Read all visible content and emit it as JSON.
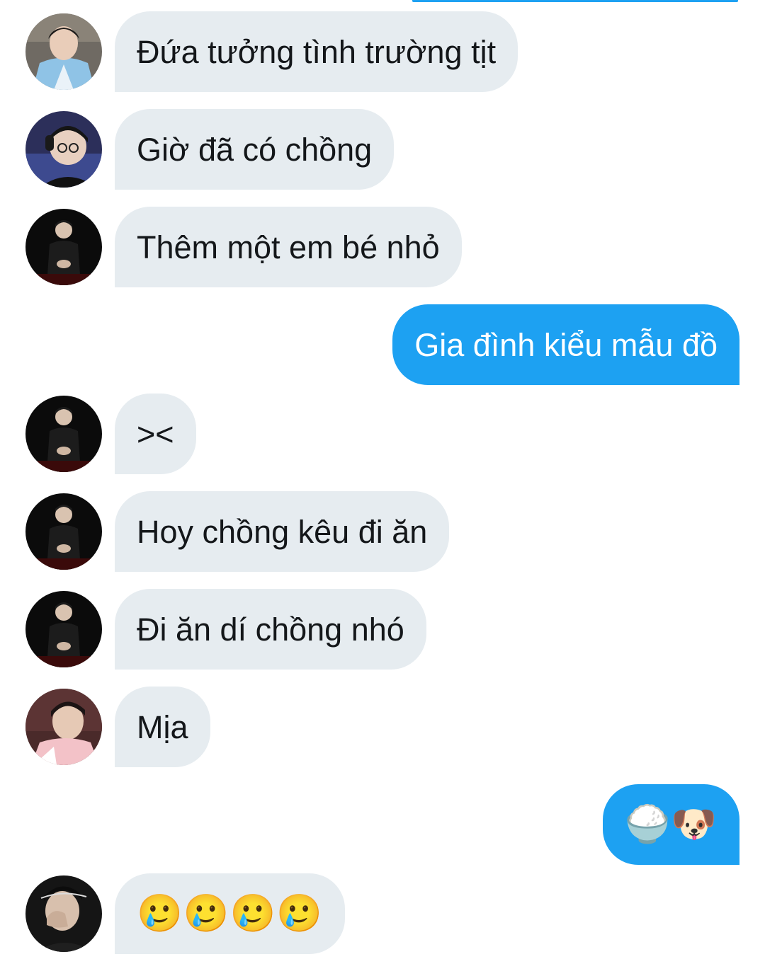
{
  "conversation": {
    "messages": [
      {
        "sender": "them",
        "avatar": "avatar-hanbok-icon",
        "text": "Đứa tưởng tình trường tịt"
      },
      {
        "sender": "them",
        "avatar": "avatar-headset-icon",
        "text": "Giờ đã có chồng"
      },
      {
        "sender": "them",
        "avatar": "avatar-black-jacket-icon",
        "text": "Thêm một em bé nhỏ"
      },
      {
        "sender": "me",
        "text": "Gia đình kiểu mẫu đồ"
      },
      {
        "sender": "them",
        "avatar": "avatar-black-jacket-icon",
        "text": "><"
      },
      {
        "sender": "them",
        "avatar": "avatar-black-jacket-icon",
        "text": "Hoy chồng kêu đi ăn"
      },
      {
        "sender": "them",
        "avatar": "avatar-black-jacket-icon",
        "text": "Đi ăn dí chồng nhó"
      },
      {
        "sender": "them",
        "avatar": "avatar-pink-jacket-icon",
        "text": "Mịa"
      },
      {
        "sender": "me",
        "text": "🍚🐶"
      },
      {
        "sender": "them",
        "avatar": "avatar-face-cover-icon",
        "text": "🥲🥲🥲🥲"
      }
    ]
  },
  "colors": {
    "incoming_bubble": "#e6ecf0",
    "outgoing_bubble": "#1da1f2",
    "incoming_text": "#14171a",
    "outgoing_text": "#ffffff"
  }
}
